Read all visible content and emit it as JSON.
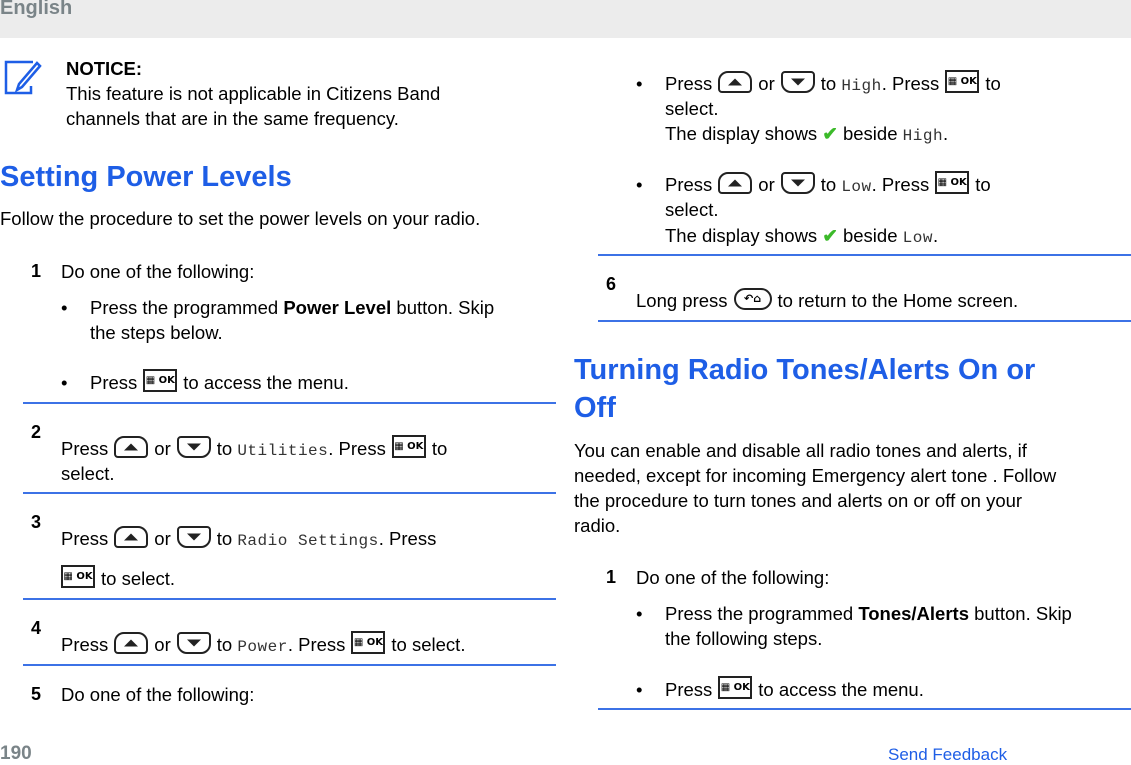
{
  "header": {
    "language": "English"
  },
  "notice": {
    "label": "NOTICE:",
    "text_line1": "This feature is not applicable in Citizens Band",
    "text_line2": "channels that are in the same frequency."
  },
  "left": {
    "title": "Setting Power Levels",
    "intro": "Follow the procedure to set the power levels on your radio.",
    "step1": {
      "num": "1",
      "text": "Do one of the following:",
      "b1_pre": "Press the programmed ",
      "b1_bold": "Power Level",
      "b1_post": " button. Skip",
      "b1_line2": "the steps below.",
      "b2_pre": "Press",
      "b2_post": "to access the menu."
    },
    "step2": {
      "num": "2",
      "press": "Press",
      "or": "or",
      "to": "to",
      "target": "Utilities",
      "press2": ". Press",
      "to2": "to",
      "line2": "select."
    },
    "step3": {
      "num": "3",
      "press": "Press",
      "or": "or",
      "to": "to",
      "target": "Radio Settings",
      "press2": ". Press",
      "line2": "to select."
    },
    "step4": {
      "num": "4",
      "press": "Press",
      "or": "or",
      "to": "to",
      "target": "Power",
      "press2": ". Press",
      "post": "to select."
    },
    "step5": {
      "num": "5",
      "text": "Do one of the following:"
    }
  },
  "right": {
    "high": {
      "press": "Press",
      "or": "or",
      "to": "to",
      "target": "High",
      "press2": ". Press",
      "to2": "to",
      "line2": "select.",
      "display_pre": "The display shows",
      "display_mid": "beside",
      "display_target": "High",
      "dot": "."
    },
    "low": {
      "press": "Press",
      "or": "or",
      "to": "to",
      "target": "Low",
      "press2": ". Press",
      "to2": "to",
      "line2": "select.",
      "display_pre": "The display shows",
      "display_mid": "beside",
      "display_target": "Low",
      "dot": "."
    },
    "step6": {
      "num": "6",
      "pre": "Long press",
      "post": "to return to the Home screen."
    },
    "title_line1": "Turning Radio Tones/Alerts On or",
    "title_line2": "Off",
    "intro_l1": "You can enable and disable all radio tones and alerts, if",
    "intro_l2": "needed, except for incoming Emergency alert tone . Follow",
    "intro_l3": "the procedure to turn tones and alerts on or off on your",
    "intro_l4": "radio.",
    "step1": {
      "num": "1",
      "text": "Do one of the following:",
      "b1_pre": "Press the programmed ",
      "b1_bold": "Tones/Alerts",
      "b1_post": " button. Skip",
      "b1_line2": "the following steps.",
      "b2_pre": "Press",
      "b2_post": "to access the menu."
    }
  },
  "icons": {
    "ok_label": "▦ OK",
    "home_label": "↶⌂",
    "check": "✔",
    "bullet": "•"
  },
  "footer": {
    "page": "190",
    "feedback": "Send Feedback"
  },
  "colors": {
    "accent": "#1e5ee6",
    "rule": "#3c72e6",
    "check": "#3cba2a",
    "footer_gray": "#7a8488"
  }
}
